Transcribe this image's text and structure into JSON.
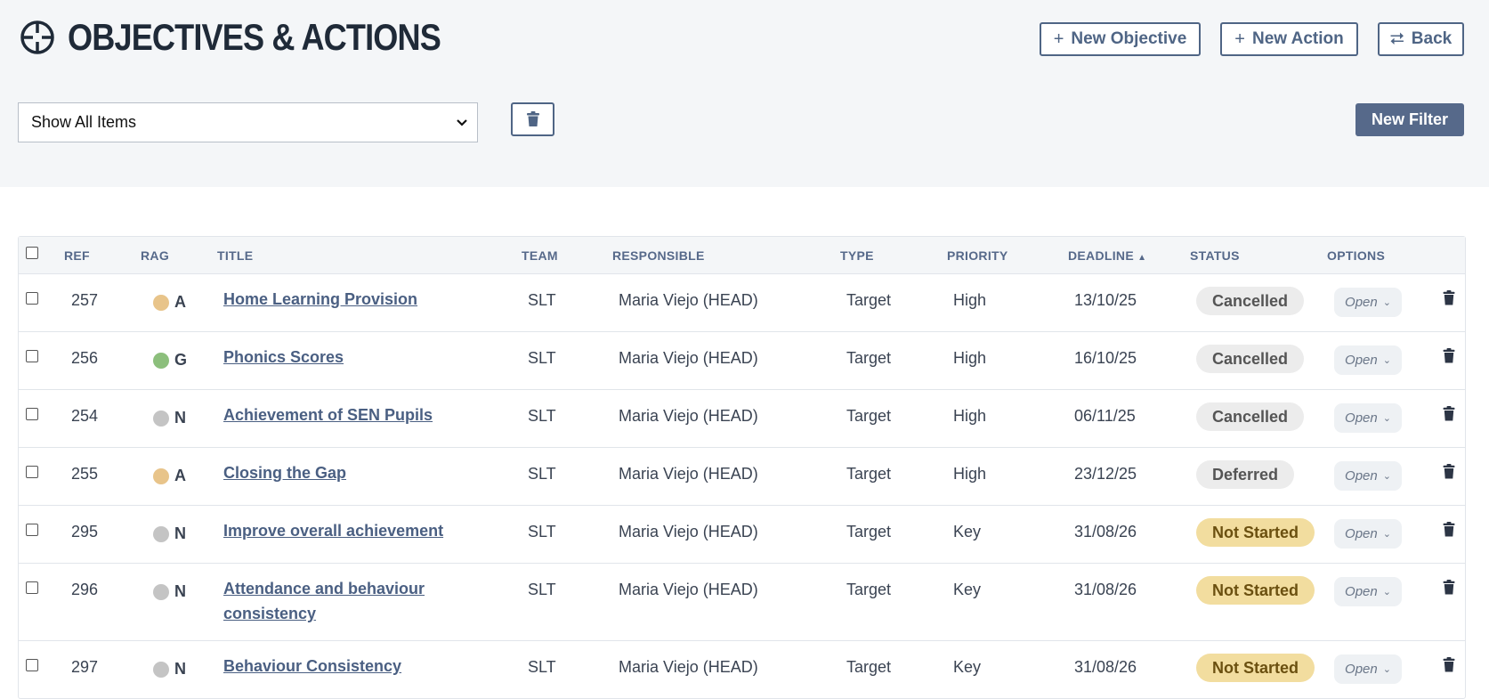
{
  "header": {
    "title": "OBJECTIVES & ACTIONS",
    "new_objective": "New Objective",
    "new_action": "New Action",
    "back": "Back"
  },
  "filter": {
    "selected": "Show All Items",
    "new_filter": "New Filter"
  },
  "table": {
    "columns": {
      "ref": "REF",
      "rag": "RAG",
      "title": "TITLE",
      "team": "TEAM",
      "responsible": "RESPONSIBLE",
      "type": "TYPE",
      "priority": "PRIORITY",
      "deadline": "DEADLINE",
      "status": "STATUS",
      "options": "OPTIONS"
    },
    "rows": [
      {
        "ref": "257",
        "rag": "A",
        "rag_color": "#e8c48a",
        "title": "Home Learning Provision",
        "team": "SLT",
        "responsible": "Maria Viejo (HEAD)",
        "type": "Target",
        "priority": "High",
        "deadline": "13/10/25",
        "status": "Cancelled",
        "option": "Open"
      },
      {
        "ref": "256",
        "rag": "G",
        "rag_color": "#8cbf7c",
        "title": "Phonics Scores",
        "team": "SLT",
        "responsible": "Maria Viejo (HEAD)",
        "type": "Target",
        "priority": "High",
        "deadline": "16/10/25",
        "status": "Cancelled",
        "option": "Open"
      },
      {
        "ref": "254",
        "rag": "N",
        "rag_color": "#c4c4c4",
        "title": "Achievement of SEN Pupils",
        "team": "SLT",
        "responsible": "Maria Viejo (HEAD)",
        "type": "Target",
        "priority": "High",
        "deadline": "06/11/25",
        "status": "Cancelled",
        "option": "Open"
      },
      {
        "ref": "255",
        "rag": "A",
        "rag_color": "#e8c48a",
        "title": "Closing the Gap",
        "team": "SLT",
        "responsible": "Maria Viejo (HEAD)",
        "type": "Target",
        "priority": "High",
        "deadline": "23/12/25",
        "status": "Deferred",
        "option": "Open"
      },
      {
        "ref": "295",
        "rag": "N",
        "rag_color": "#c4c4c4",
        "title": "Improve overall achievement",
        "team": "SLT",
        "responsible": "Maria Viejo (HEAD)",
        "type": "Target",
        "priority": "Key",
        "deadline": "31/08/26",
        "status": "Not Started",
        "option": "Open"
      },
      {
        "ref": "296",
        "rag": "N",
        "rag_color": "#c4c4c4",
        "title": "Attendance and behaviour consistency",
        "team": "SLT",
        "responsible": "Maria Viejo (HEAD)",
        "type": "Target",
        "priority": "Key",
        "deadline": "31/08/26",
        "status": "Not Started",
        "option": "Open"
      },
      {
        "ref": "297",
        "rag": "N",
        "rag_color": "#c4c4c4",
        "title": "Behaviour Consistency",
        "team": "SLT",
        "responsible": "Maria Viejo (HEAD)",
        "type": "Target",
        "priority": "Key",
        "deadline": "31/08/26",
        "status": "Not Started",
        "option": "Open"
      }
    ]
  },
  "colors": {
    "accent": "#4f6585",
    "status_grey_bg": "#ececec",
    "status_grey_text": "#555555",
    "status_yellow_bg": "#f2dd9f",
    "status_yellow_text": "#6b5010"
  }
}
